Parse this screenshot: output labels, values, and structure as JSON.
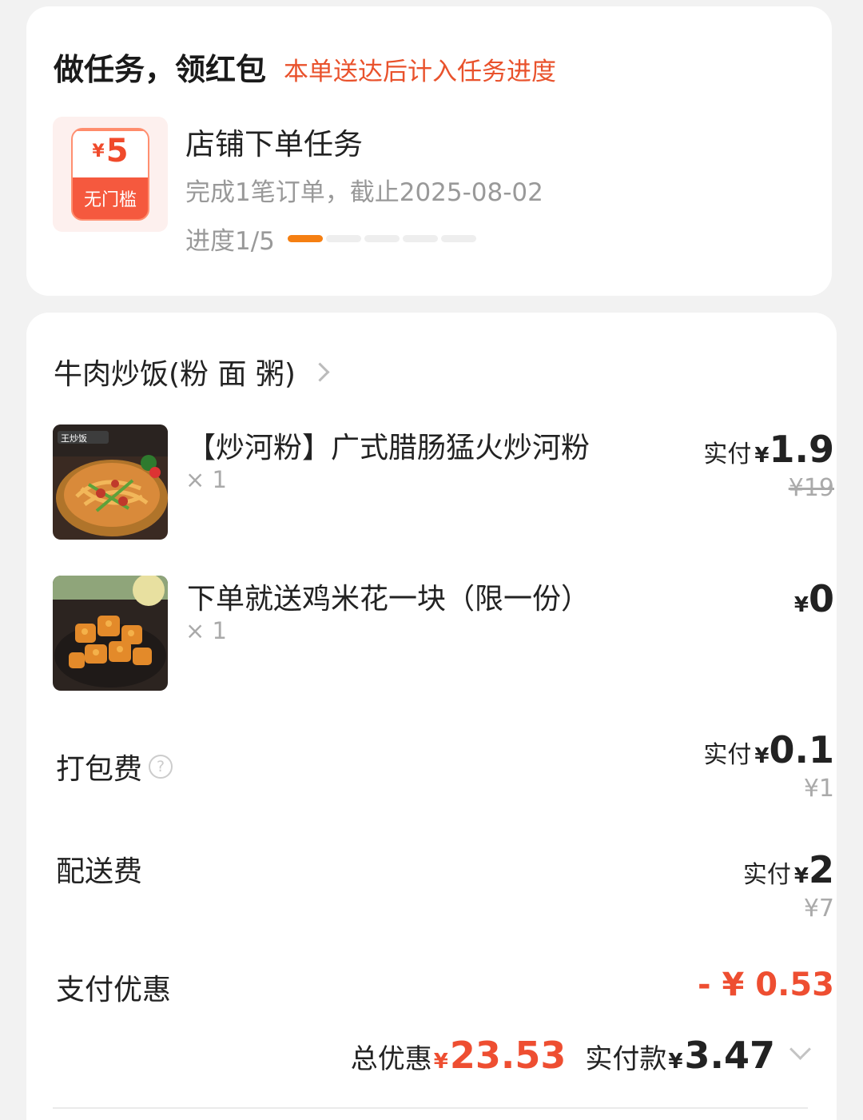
{
  "task": {
    "title": "做任务，领红包",
    "note": "本单送达后计入任务进度",
    "coupon_currency": "¥",
    "coupon_amount": "5",
    "coupon_label": "无门槛",
    "name": "店铺下单任务",
    "desc": "完成1笔订单，截止2025-08-02",
    "progress_label": "进度1/5",
    "progress_done": 1,
    "progress_total": 5,
    "colors": {
      "accent": "#e9522c",
      "progress": "#f57f12"
    }
  },
  "shop": {
    "name": "牛肉炒饭(粉 面 粥)"
  },
  "items": [
    {
      "name": "【炒河粉】广式腊肠猛火炒河粉",
      "qty": "× 1",
      "pay_prefix": "实付",
      "currency": "¥",
      "price": "1.9",
      "original": "¥19"
    },
    {
      "name": "下单就送鸡米花一块（限一份）",
      "qty": "× 1",
      "currency": "¥",
      "price": "0"
    }
  ],
  "fees": {
    "packing": {
      "label": "打包费",
      "help_icon": "question-circle-icon",
      "pay_prefix": "实付",
      "currency": "¥",
      "price": "0.1",
      "original": "¥1"
    },
    "delivery": {
      "label": "配送费",
      "pay_prefix": "实付",
      "currency": "¥",
      "price": "2",
      "original": "¥7"
    },
    "payment_discount": {
      "label": "支付优惠",
      "value": "- ¥ 0.53"
    }
  },
  "summary": {
    "total_discount_label": "总优惠",
    "total_discount_currency": "¥",
    "total_discount": "23.53",
    "paid_label": "实付款",
    "paid_currency": "¥",
    "paid": "3.47"
  }
}
